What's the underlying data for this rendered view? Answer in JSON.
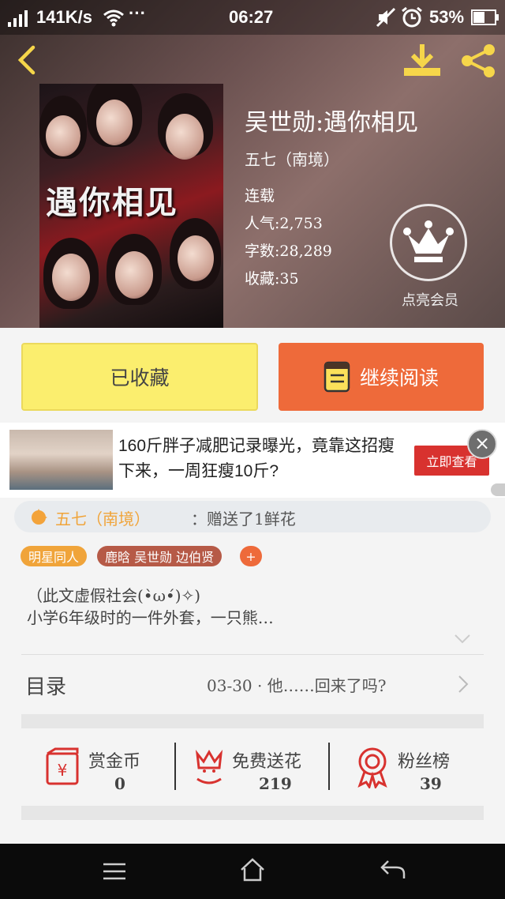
{
  "status_bar": {
    "speed": "141K/s",
    "more": "···",
    "time": "06:27",
    "battery": "53%"
  },
  "header": {
    "cover_text": "遇你相见",
    "title": "吴世勋:遇你相见",
    "author": "五七（南境）",
    "status": "连载",
    "popularity": "人气:2,753",
    "word_count": "字数:28,289",
    "favorites": "收藏:35",
    "vip_label": "点亮会员"
  },
  "actions": {
    "collected_label": "已收藏",
    "read_label": "继续阅读"
  },
  "ad": {
    "text": "160斤胖子减肥记录曝光，竟靠这招瘦下来，一周狂瘦10斤?",
    "button": "立即查看"
  },
  "gift": {
    "user": "五七（南境）",
    "message": "：赠送了1鲜花"
  },
  "tags": [
    "明星同人",
    "鹿晗 吴世勋 边伯贤",
    "+"
  ],
  "description": {
    "line1": "（此文虚假社会(•̀ω•́)✧)",
    "line2": "小学6年级时的一件外套，一只熊…"
  },
  "toc": {
    "label": "目录",
    "latest": "03-30 · 他……回来了吗?"
  },
  "stats": [
    {
      "label": "赏金币",
      "value": "0"
    },
    {
      "label": "免费送花",
      "value": "219"
    },
    {
      "label": "粉丝榜",
      "value": "39"
    }
  ],
  "colors": {
    "accent_orange": "#ee6a3a",
    "collected_yellow": "#fbee6e",
    "tag_orange": "#f0a43a",
    "tag_brown": "#b65a47",
    "icon_red": "#d8322f"
  }
}
